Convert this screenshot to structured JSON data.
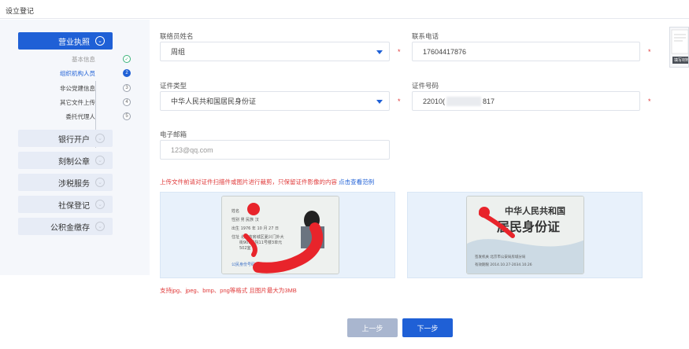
{
  "page": {
    "title": "设立登记"
  },
  "sidebar": {
    "active": {
      "label": "营业执照",
      "icon": "chevron-down-icon"
    },
    "steps": [
      {
        "label": "基本信息",
        "marker": "✓",
        "state": "done"
      },
      {
        "label": "组织机构人员",
        "marker": "2",
        "state": "current"
      },
      {
        "label": "非公党建信息",
        "marker": "3",
        "state": "todo"
      },
      {
        "label": "其它文件上传",
        "marker": "4",
        "state": "todo"
      },
      {
        "label": "委托代理人",
        "marker": "5",
        "state": "todo"
      }
    ],
    "items": [
      {
        "label": "银行开户"
      },
      {
        "label": "刻制公章"
      },
      {
        "label": "涉税服务"
      },
      {
        "label": "社保登记"
      },
      {
        "label": "公积金缴存"
      }
    ]
  },
  "form": {
    "contact_name": {
      "label": "联络员姓名",
      "value": "周组"
    },
    "phone": {
      "label": "联系电话",
      "value": "17604417876"
    },
    "id_type": {
      "label": "证件类型",
      "value": "中华人民共和国居民身份证"
    },
    "id_number": {
      "label": "证件号码",
      "prefix": "22010(",
      "suffix": "817"
    },
    "email": {
      "label": "电子邮箱",
      "placeholder": "123@qq.com"
    },
    "required_mark": "*"
  },
  "upload": {
    "notice": "上传文件前请对证件扫描件或图片进行裁剪，只保留证件影像的内容 ",
    "notice_link": "点击查看范例",
    "hint": "支持jpg、jpeg、bmp、png等格式 且图片最大为3MB"
  },
  "card_front": {
    "lines": [
      "姓名",
      "性别 男 民族 汉",
      "出生 1976 年 10 月 27 日",
      "住址 北京市房城区夏兴门外大",
      "街909号院11号楼3单元",
      "502室",
      "公民身份号码"
    ]
  },
  "card_back": {
    "line1": "中华人民共和国",
    "line2": "居民身份证",
    "issuer": "签发机关  北京市公安局房城分局",
    "valid": "有效期限  2014.10.27-2034.10.26"
  },
  "thumb": {
    "tag": "填写材料"
  },
  "buttons": {
    "prev": "上一步",
    "next": "下一步"
  },
  "colors": {
    "primary": "#1f60d6",
    "danger": "#e03b3b",
    "sidebar_bg": "#f5f7fb",
    "upload_bg": "#e8f1fb"
  }
}
